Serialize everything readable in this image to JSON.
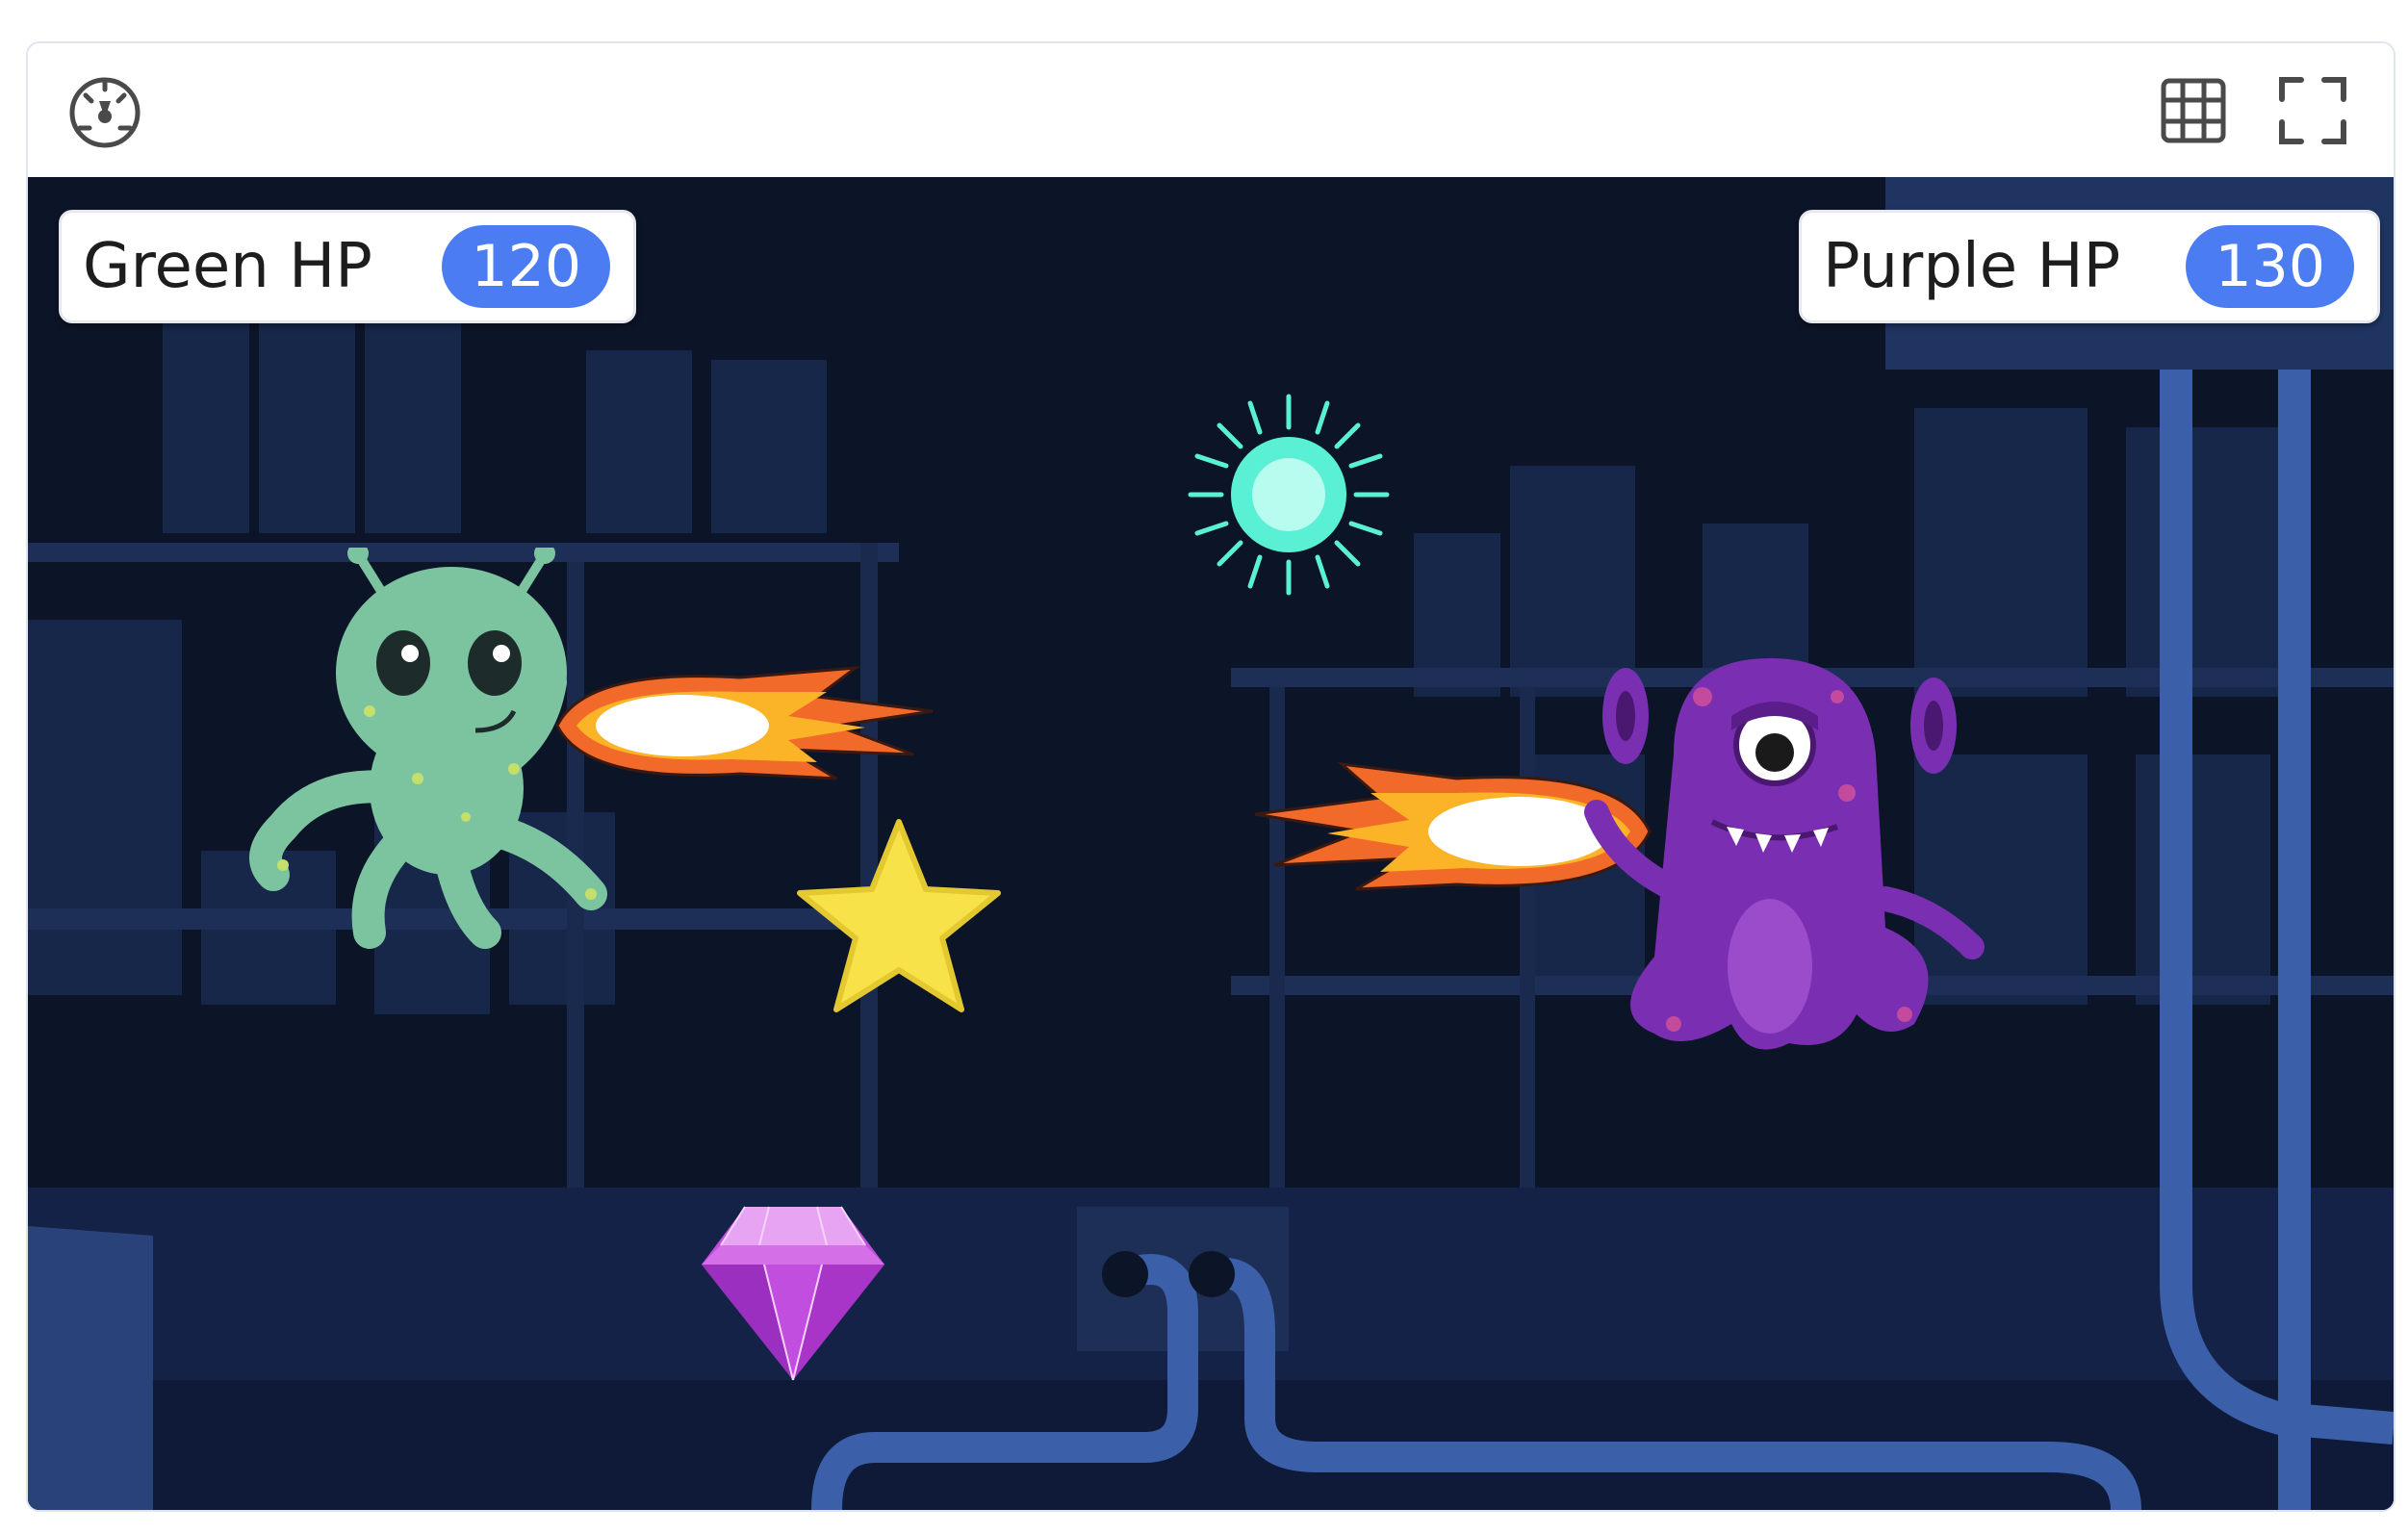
{
  "toolbar": {
    "left_icon": "speedometer-icon",
    "right_icons": [
      "grid-icon",
      "fullscreen-icon"
    ]
  },
  "hud": {
    "green": {
      "label": "Green HP",
      "value": "120"
    },
    "purple": {
      "label": "Purple HP",
      "value": "130"
    }
  },
  "sprites": [
    "green-alien",
    "purple-monster",
    "fireball",
    "fireball",
    "yellow-star",
    "cyan-orb",
    "purple-gem"
  ],
  "colors": {
    "accent": "#4c7cf2",
    "stage_bg": "#0c1427",
    "green_alien": "#7cc4a0",
    "purple_monster": "#7a2fb3",
    "star": "#f7e24a",
    "orb": "#59f0d6",
    "gem": "#c24ee0"
  }
}
